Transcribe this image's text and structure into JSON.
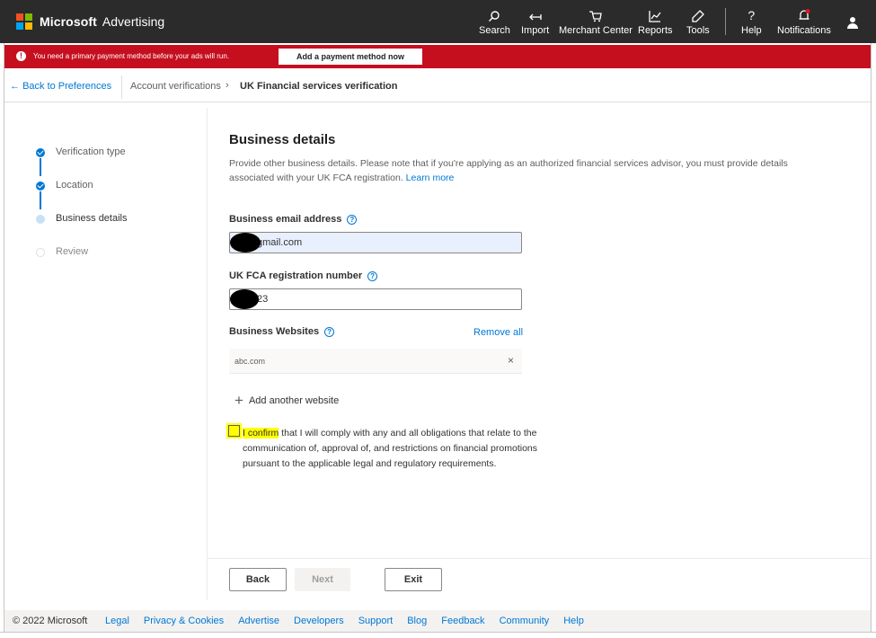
{
  "brand": {
    "company": "Microsoft",
    "product": "Advertising"
  },
  "nav": [
    {
      "label": "Search",
      "icon": "search-icon"
    },
    {
      "label": "Import",
      "icon": "import-icon"
    },
    {
      "label": "Merchant Center",
      "icon": "cart-icon"
    },
    {
      "label": "Reports",
      "icon": "reports-icon"
    },
    {
      "label": "Tools",
      "icon": "tools-icon"
    },
    {
      "label": "Help",
      "icon": "help-icon"
    },
    {
      "label": "Notifications",
      "icon": "bell-icon"
    }
  ],
  "banner": {
    "message": "You need a primary payment method before your ads will run.",
    "button": "Add a payment method now",
    "color": "#c50f1f"
  },
  "breadcrumb": {
    "back": "Back to Preferences",
    "level2": "Account verifications",
    "current": "UK Financial services verification"
  },
  "steps": [
    {
      "label": "Verification type",
      "status": "done"
    },
    {
      "label": "Location",
      "status": "done"
    },
    {
      "label": "Business details",
      "status": "current"
    },
    {
      "label": "Review",
      "status": "todo"
    }
  ],
  "form": {
    "title": "Business details",
    "description": "Provide other business details. Please note that if you're applying as an authorized financial services advisor, you must provide details associated with your UK FCA registration.",
    "learn_more": "Learn more",
    "email_label": "Business email address",
    "email_value": "gmail.com",
    "fca_label": "UK FCA registration number",
    "fca_value": "23",
    "websites_label": "Business Websites",
    "remove_all": "Remove all",
    "website": "abc.com",
    "add_website": "Add another website",
    "confirm_highlight": "I confirm",
    "confirm_rest": " that I will comply with any and all obligations that relate to the communication of, approval of, and restrictions on financial promotions pursuant to the applicable legal and regulatory requirements."
  },
  "buttons": {
    "back": "Back",
    "next": "Next",
    "exit": "Exit"
  },
  "footer": {
    "copyright": "© 2022 Microsoft",
    "links": [
      "Legal",
      "Privacy & Cookies",
      "Advertise",
      "Developers",
      "Support",
      "Blog",
      "Feedback",
      "Community",
      "Help"
    ]
  },
  "colors": {
    "accent": "#0078d4",
    "topbar": "#2b2b2b",
    "highlight": "#ffff00"
  }
}
